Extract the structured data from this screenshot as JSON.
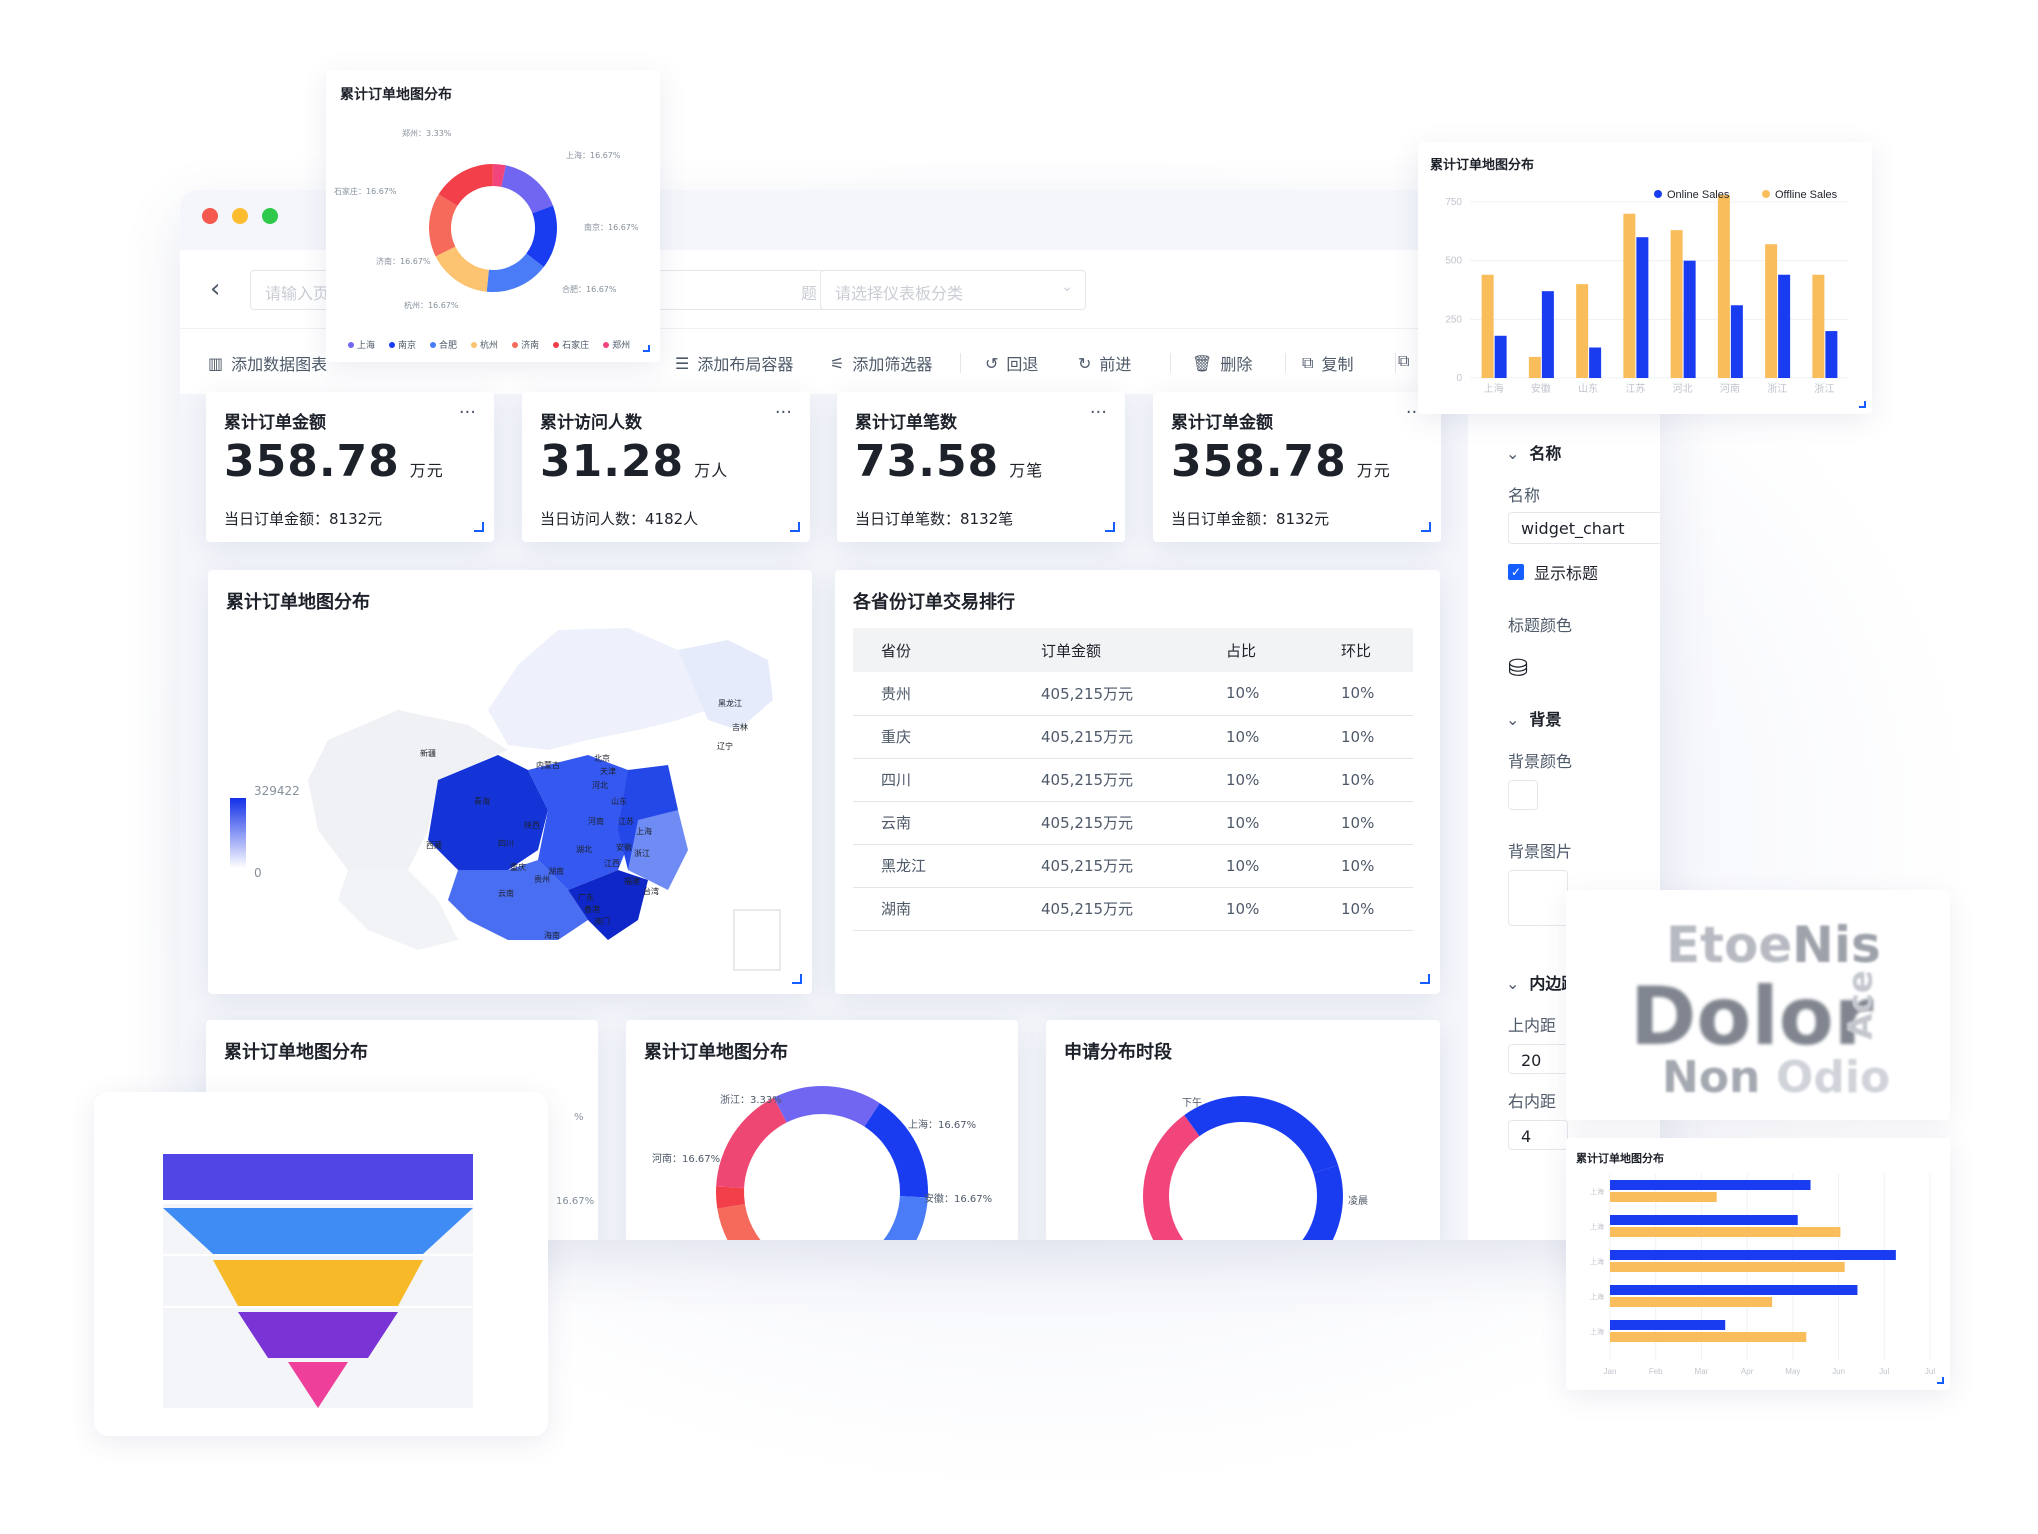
{
  "window": {
    "traffic_lights": [
      "#f4584f",
      "#fbbc2f",
      "#2fc84a"
    ],
    "page_name_placeholder": "请输入页",
    "title_placeholder": "题",
    "category_placeholder": "请选择仪表板分类"
  },
  "toolbar": {
    "add_chart": "添加数据图表",
    "add_container": "添加布局容器",
    "add_filter": "添加筛选器",
    "undo": "回退",
    "redo": "前进",
    "delete": "删除",
    "copy": "复制"
  },
  "kpis": [
    {
      "title": "累计订单金额",
      "value": "358.78",
      "unit": "万元",
      "sub": "当日订单金额：8132元"
    },
    {
      "title": "累计访问人数",
      "value": "31.28",
      "unit": "万人",
      "sub": "当日访问人数：4182人"
    },
    {
      "title": "累计订单笔数",
      "value": "73.58",
      "unit": "万笔",
      "sub": "当日订单笔数：8132笔"
    },
    {
      "title": "累计订单金额",
      "value": "358.78",
      "unit": "万元",
      "sub": "当日订单金额：8132元"
    }
  ],
  "map_card": {
    "title": "累计订单地图分布",
    "legend_max": "329422",
    "legend_min": "0",
    "place_labels": [
      "黑龙江",
      "吉林",
      "辽宁",
      "新疆",
      "内蒙古",
      "北京",
      "天津",
      "河北",
      "山东",
      "西藏",
      "青海",
      "江苏",
      "上海",
      "河南",
      "安徽",
      "湖北",
      "浙江",
      "江西",
      "贵州",
      "福建",
      "云南",
      "台湾",
      "广东",
      "香港",
      "澳门",
      "海南",
      "四川",
      "陕西",
      "湖南",
      "重庆"
    ]
  },
  "rank_card": {
    "title": "各省份订单交易排行",
    "columns": [
      "省份",
      "订单金额",
      "占比",
      "环比"
    ],
    "rows": [
      [
        "贵州",
        "405,215万元",
        "10%",
        "10%"
      ],
      [
        "重庆",
        "405,215万元",
        "10%",
        "10%"
      ],
      [
        "四川",
        "405,215万元",
        "10%",
        "10%"
      ],
      [
        "云南",
        "405,215万元",
        "10%",
        "10%"
      ],
      [
        "黑龙江",
        "405,215万元",
        "10%",
        "10%"
      ],
      [
        "湖南",
        "405,215万元",
        "10%",
        "10%"
      ]
    ]
  },
  "bottom_cards": [
    {
      "title": "累计订单地图分布"
    },
    {
      "title": "累计订单地图分布",
      "labels": [
        "浙江：3.33%",
        "上海：16.67%",
        "河南：16.67%",
        "安徽：16.67%"
      ]
    },
    {
      "title": "申请分布时段",
      "labels": [
        "下午",
        "凌晨"
      ]
    }
  ],
  "bottom_left_partial_labels": [
    "%",
    "16.67%"
  ],
  "settings": {
    "sec_name": "名称",
    "name_label": "名称",
    "name_value": "widget_chart",
    "show_title": "显示标题",
    "title_color": "标题颜色",
    "sec_bg": "背景",
    "bg_color": "背景颜色",
    "bg_image": "背景图片",
    "sec_padding": "内边距",
    "pad_top_label": "上内距",
    "pad_top_value": "20",
    "pad_right_label": "右内距",
    "pad_right_value": "4"
  },
  "float_donut": {
    "title": "累计订单地图分布",
    "slice_labels": [
      "郑州：3.33%",
      "上海：16.67%",
      "南京：16.67%",
      "合肥：16.67%",
      "杭州：16.67%",
      "济南：16.67%",
      "石家庄：16.67%"
    ],
    "legend": [
      "上海",
      "南京",
      "合肥",
      "杭州",
      "济南",
      "石家庄",
      "郑州"
    ]
  },
  "float_wordcloud": {
    "words": [
      "Etoe",
      "Nis",
      "Dolor",
      "Ace",
      "Non",
      "Odio"
    ]
  },
  "float_hbar": {
    "title": "累计订单地图分布",
    "y_labels": [
      "上海",
      "上海",
      "上海",
      "上海",
      "上海"
    ],
    "x_labels": [
      "Jan",
      "Feb",
      "Mar",
      "Apr",
      "May",
      "Jun",
      "Jul",
      "Jul"
    ]
  },
  "funnel": {
    "stages": [
      "#5145e6",
      "#3f8cf5",
      "#f7b928",
      "#7a33d4",
      "#ee3f9a"
    ]
  },
  "chart_data": [
    {
      "type": "bar",
      "title": "累计订单地图分布",
      "categories": [
        "上海",
        "安徽",
        "山东",
        "江苏",
        "河北",
        "河南",
        "浙江",
        "浙江"
      ],
      "series": [
        {
          "name": "Online Sales",
          "color": "#1a3cf0",
          "values": [
            180,
            370,
            130,
            600,
            500,
            310,
            440,
            200
          ]
        },
        {
          "name": "Offline Sales",
          "color": "#f9bd5b",
          "values": [
            440,
            90,
            400,
            700,
            630,
            780,
            570,
            440
          ]
        }
      ],
      "ylim": [
        0,
        750
      ],
      "yticks": [
        "0",
        "250",
        "500",
        "750"
      ],
      "legend": "top-right"
    },
    {
      "type": "pie",
      "title": "累计订单地图分布",
      "labels": [
        "上海",
        "南京",
        "合肥",
        "杭州",
        "济南",
        "石家庄",
        "郑州"
      ],
      "values": [
        16.67,
        16.67,
        16.67,
        16.67,
        16.67,
        16.67,
        3.33
      ]
    },
    {
      "type": "bar",
      "title": "累计订单地图分布",
      "categories": [
        "上海",
        "上海",
        "上海",
        "上海",
        "上海"
      ],
      "series": [
        {
          "name": "",
          "color": "#1a3cf0",
          "values": [
            4.7,
            4.4,
            6.7,
            5.8,
            2.7
          ]
        },
        {
          "name": "",
          "color": "#f9bd5b",
          "values": [
            2.5,
            5.4,
            5.5,
            3.8,
            4.6
          ]
        }
      ],
      "orientation": "horizontal"
    }
  ]
}
